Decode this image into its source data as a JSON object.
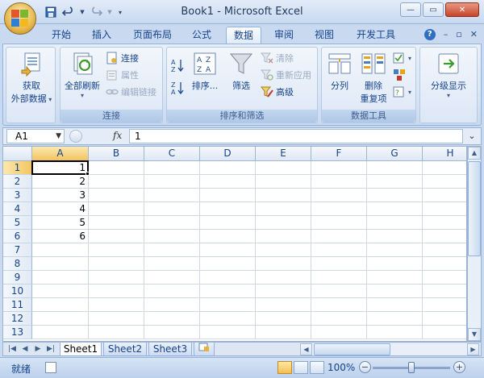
{
  "window": {
    "title": "Book1 - Microsoft Excel",
    "min_label": "—",
    "restore_label": "▭",
    "close_label": "✕"
  },
  "qat": {
    "save_icon": "save-icon",
    "undo_icon": "undo-icon",
    "redo_icon": "redo-icon",
    "customize_icon": "customize-icon"
  },
  "tabs": [
    {
      "label": "开始"
    },
    {
      "label": "插入"
    },
    {
      "label": "页面布局"
    },
    {
      "label": "公式"
    },
    {
      "label": "数据",
      "active": true
    },
    {
      "label": "审阅"
    },
    {
      "label": "视图"
    },
    {
      "label": "开发工具"
    }
  ],
  "tab_controls": {
    "help": "?",
    "min": "–",
    "restore": "▫",
    "close": "✕"
  },
  "ribbon": {
    "get_external": {
      "line1": "获取",
      "line2": "外部数据"
    },
    "connections": {
      "refresh_all": "全部刷新",
      "connections": "连接",
      "properties": "属性",
      "edit_links": "编辑链接",
      "group_label": "连接"
    },
    "sort_filter": {
      "sort": "排序...",
      "filter": "筛选",
      "clear": "清除",
      "reapply": "重新应用",
      "advanced": "高级",
      "group_label": "排序和筛选"
    },
    "data_tools": {
      "text_to_columns": "分列",
      "remove_dup_1": "删除",
      "remove_dup_2": "重复项",
      "group_label": "数据工具"
    },
    "outline": {
      "label": "分级显示"
    }
  },
  "formula_bar": {
    "name_box": "A1",
    "fx": "fx",
    "value": "1"
  },
  "grid": {
    "columns": [
      "A",
      "B",
      "C",
      "D",
      "E",
      "F",
      "G",
      "H"
    ],
    "rows": [
      "1",
      "2",
      "3",
      "4",
      "5",
      "6",
      "7",
      "8",
      "9",
      "10",
      "11",
      "12",
      "13"
    ],
    "col_a_values": [
      "1",
      "2",
      "3",
      "4",
      "5",
      "6"
    ],
    "active_cell": "A1"
  },
  "sheets": [
    {
      "label": "Sheet1",
      "active": true
    },
    {
      "label": "Sheet2"
    },
    {
      "label": "Sheet3"
    }
  ],
  "status": {
    "ready": "就绪",
    "zoom": "100%",
    "zoom_minus": "−",
    "zoom_plus": "+"
  }
}
